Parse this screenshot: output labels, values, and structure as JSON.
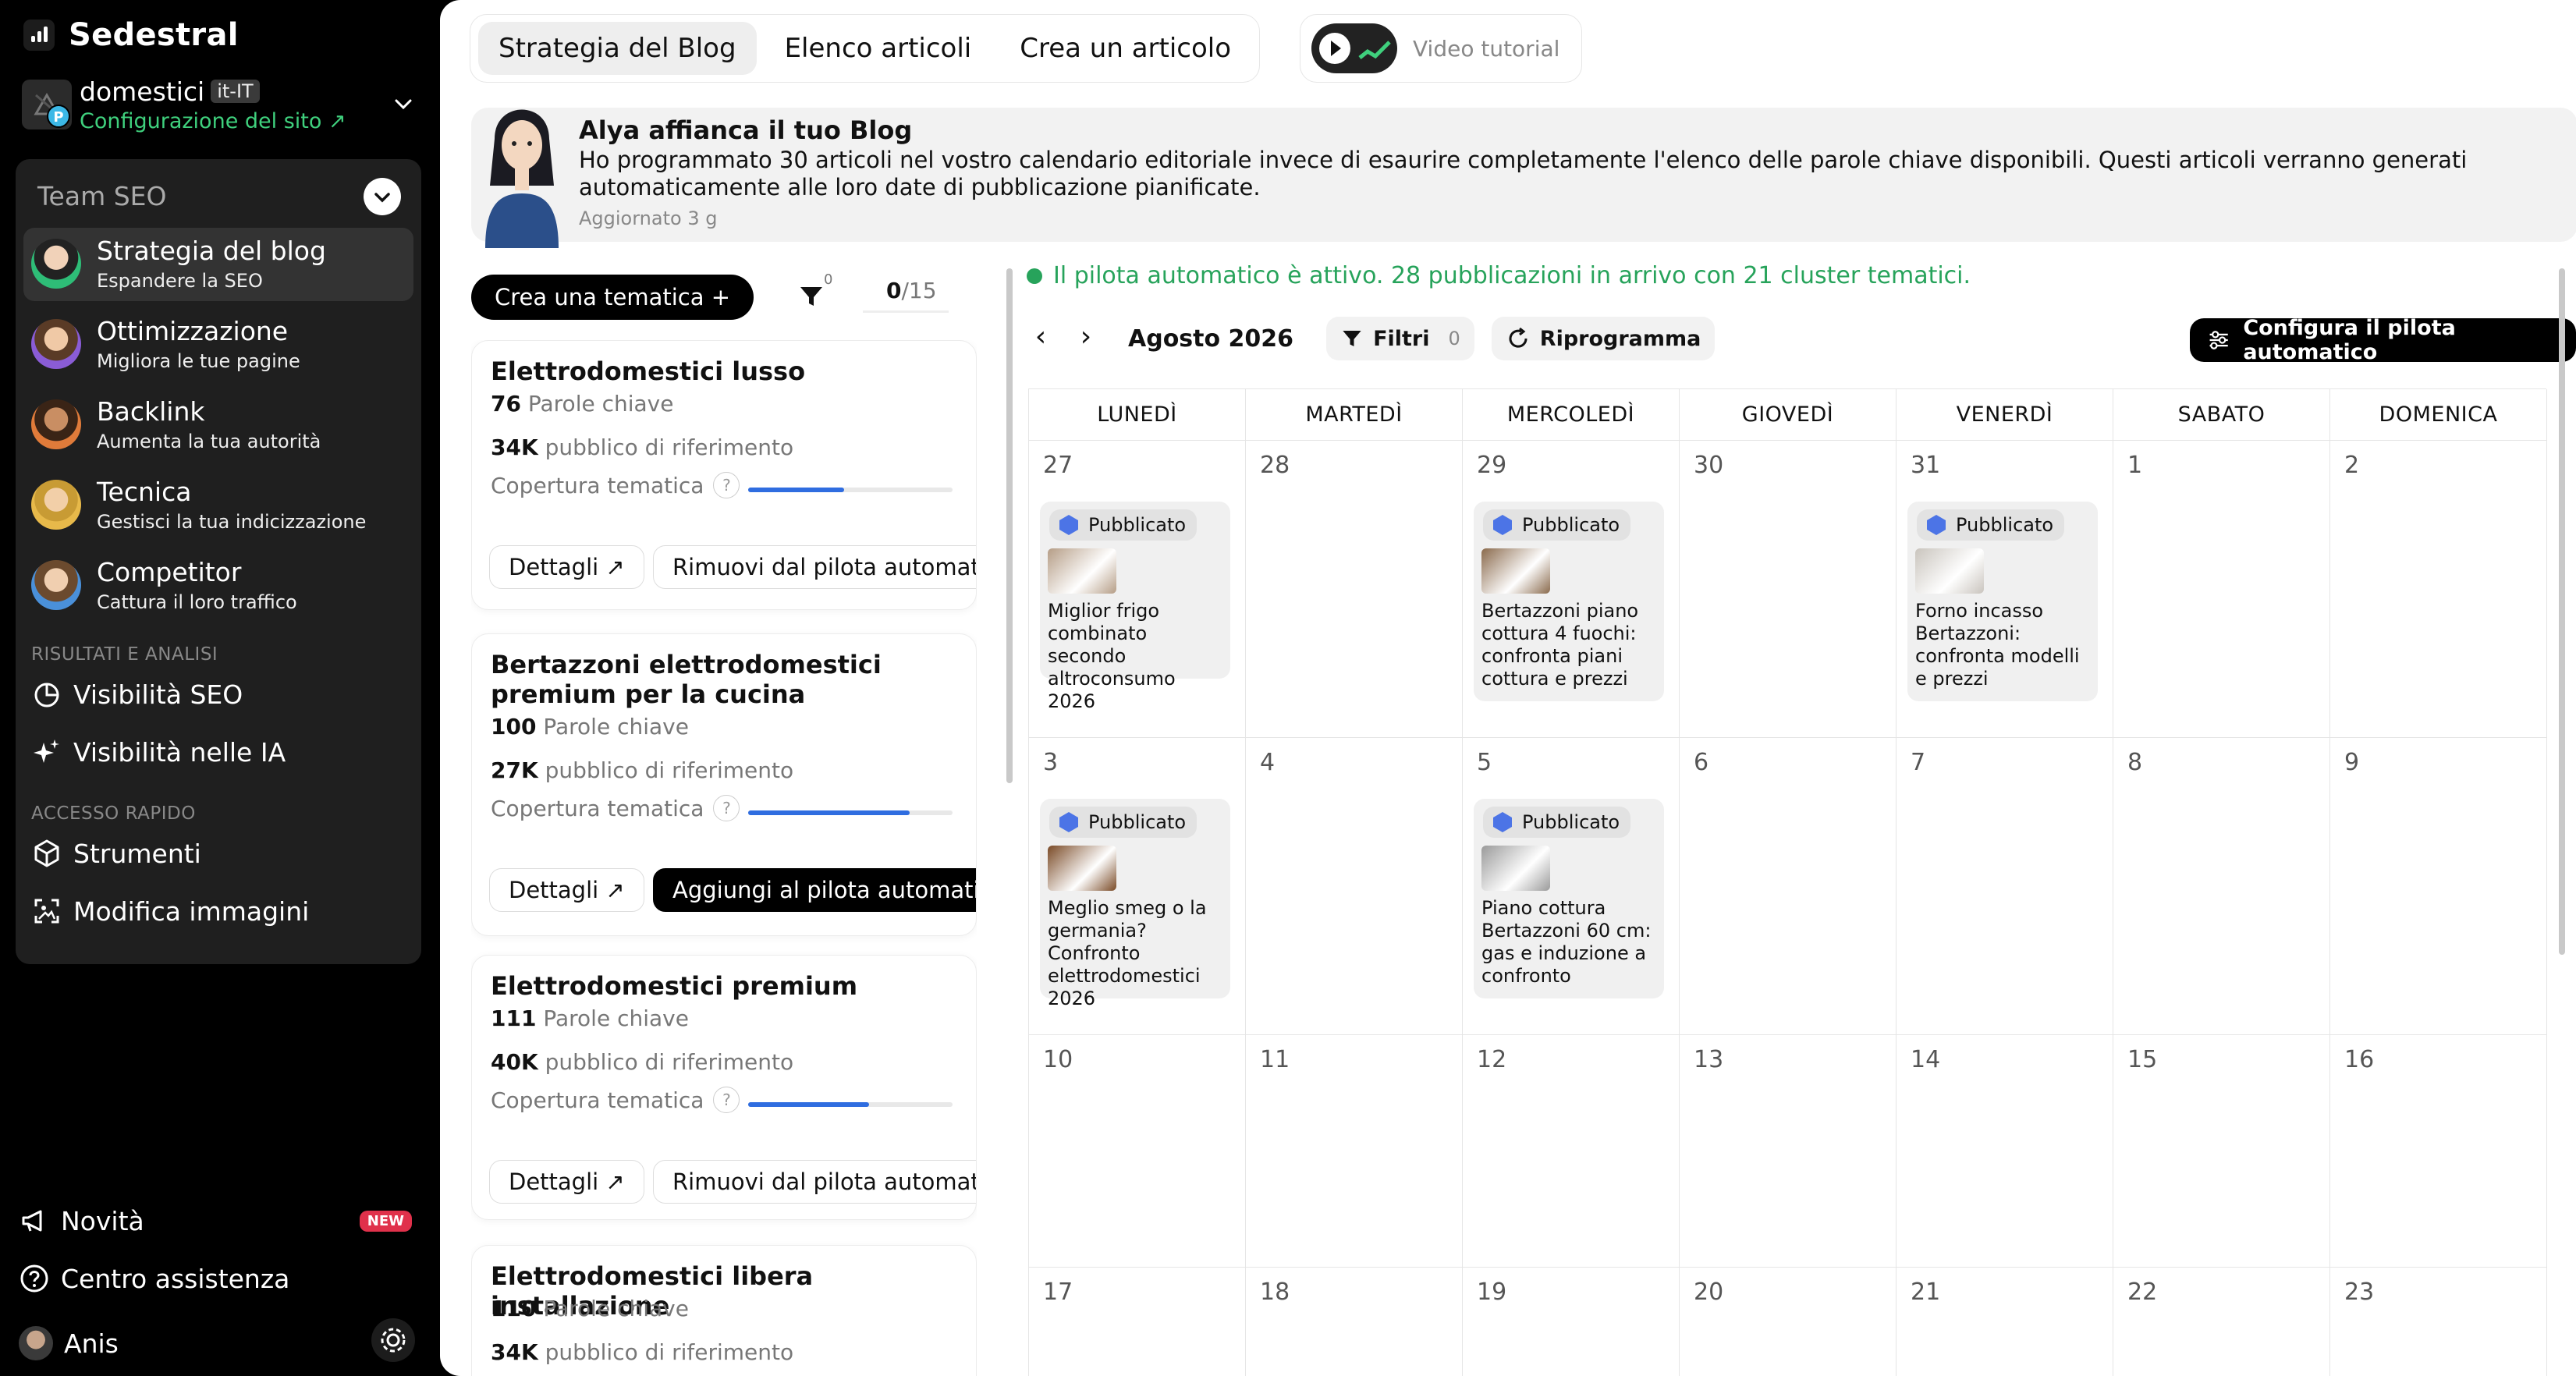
{
  "sidebar": {
    "brand": "Sedestral",
    "site": {
      "domain": "domestici",
      "locale": "it-IT",
      "config_label": "Configurazione del sito ↗",
      "badge_letter": "P"
    },
    "team_label": "Team SEO",
    "nav": [
      {
        "title": "Strategia del blog",
        "subtitle": "Espandere la SEO",
        "active": true
      },
      {
        "title": "Ottimizzazione",
        "subtitle": "Migliora le tue pagine"
      },
      {
        "title": "Backlink",
        "subtitle": "Aumenta la tua autorità"
      },
      {
        "title": "Tecnica",
        "subtitle": "Gestisci la tua indicizzazione"
      },
      {
        "title": "Competitor",
        "subtitle": "Cattura il loro traffico"
      }
    ],
    "section_results": "RISULTATI E ANALISI",
    "results_links": [
      "Visibilità SEO",
      "Visibilità nelle IA"
    ],
    "section_quick": "ACCESSO RAPIDO",
    "quick_links": [
      "Strumenti",
      "Modifica immagini"
    ],
    "news_label": "Novità",
    "news_badge": "NEW",
    "help_label": "Centro assistenza",
    "user_name": "Anis"
  },
  "tabs": [
    "Strategia del Blog",
    "Elenco articoli",
    "Crea un articolo"
  ],
  "tutorial_label": "Video tutorial",
  "alya": {
    "title": "Alya affianca il tuo Blog",
    "message": "Ho programmato 30 articoli nel vostro calendario editoriale invece di esaurire completamente l'elenco delle parole chiave disponibili. Questi articoli verranno generati automaticamente alle loro date di pubblicazione pianificate.",
    "updated": "Aggiornato 3 g"
  },
  "themes_toolbar": {
    "create_label": "Crea una tematica +",
    "filter_count": "0",
    "progress_done": "0",
    "progress_total": "/15"
  },
  "themes": [
    {
      "title": "Elettrodomestici lusso",
      "keywords": "76",
      "keywords_label": "Parole chiave",
      "audience": "34K",
      "audience_label": "pubblico di riferimento",
      "coverage_label": "Copertura tematica",
      "coverage": 0.47,
      "details": "Dettagli ↗",
      "action": "Rimuovi dal pilota automatico",
      "action_dark": false
    },
    {
      "title": "Bertazzoni elettrodomestici premium per la cucina",
      "keywords": "100",
      "keywords_label": "Parole chiave",
      "audience": "27K",
      "audience_label": "pubblico di riferimento",
      "coverage_label": "Copertura tematica",
      "coverage": 0.79,
      "details": "Dettagli ↗",
      "action": "Aggiungi al pilota automatico",
      "action_dark": true
    },
    {
      "title": "Elettrodomestici premium",
      "keywords": "111",
      "keywords_label": "Parole chiave",
      "audience": "40K",
      "audience_label": "pubblico di riferimento",
      "coverage_label": "Copertura tematica",
      "coverage": 0.59,
      "details": "Dettagli ↗",
      "action": "Rimuovi dal pilota automatico",
      "action_dark": false
    },
    {
      "title": "Elettrodomestici libera installazione",
      "keywords": "110",
      "keywords_label": "Parole chiave",
      "audience": "34K",
      "audience_label": "pubblico di riferimento"
    }
  ],
  "calendar": {
    "status": "Il pilota automatico è attivo. 28 pubblicazioni in arrivo con 21 cluster tematici.",
    "month": "Agosto 2026",
    "filters_label": "Filtri",
    "filters_count": "0",
    "reschedule_label": "Riprogramma",
    "config_label": "Configura il pilota automatico",
    "weekdays": [
      "LUNEDÌ",
      "MARTEDÌ",
      "MERCOLEDÌ",
      "GIOVEDÌ",
      "VENERDÌ",
      "SABATO",
      "DOMENICA"
    ],
    "weeks": [
      [
        "27",
        "28",
        "29",
        "30",
        "31",
        "1",
        "2"
      ],
      [
        "3",
        "4",
        "5",
        "6",
        "7",
        "8",
        "9"
      ],
      [
        "10",
        "11",
        "12",
        "13",
        "14",
        "15",
        "16"
      ],
      [
        "17",
        "18",
        "19",
        "20",
        "21",
        "22",
        "23"
      ]
    ],
    "posts": [
      {
        "week": 0,
        "day": 0,
        "status": "Pubblicato",
        "title": "Miglior frigo combinato secondo altroconsumo 2026",
        "img": "#b59d86"
      },
      {
        "week": 0,
        "day": 2,
        "status": "Pubblicato",
        "title": "Bertazzoni piano cottura 4 fuochi: confronta piani cottura e prezzi",
        "img": "#8a6a4c"
      },
      {
        "week": 0,
        "day": 4,
        "status": "Pubblicato",
        "title": "Forno incasso Bertazzoni: confronta modelli e prezzi",
        "img": "#c9c4bd"
      },
      {
        "week": 1,
        "day": 0,
        "status": "Pubblicato",
        "title": "Meglio smeg o la germania? Confronto elettrodomestici 2026",
        "img": "#7a4a26"
      },
      {
        "week": 1,
        "day": 2,
        "status": "Pubblicato",
        "title": "Piano cottura Bertazzoni 60 cm: gas e induzione a confronto",
        "img": "#9a9a9a"
      }
    ]
  },
  "colors": {
    "accent_green": "#27a35b",
    "progress_blue": "#2f6de0",
    "badge_red": "#e0314b",
    "published_hex": "#4c74e6"
  }
}
